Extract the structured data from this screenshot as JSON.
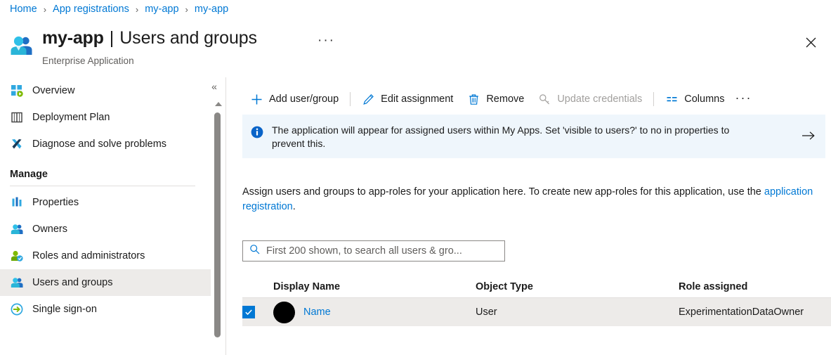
{
  "breadcrumb": {
    "items": [
      "Home",
      "App registrations",
      "my-app",
      "my-app"
    ],
    "separator": "›"
  },
  "header": {
    "icon": "users-group-icon",
    "title_bold": "my-app",
    "title_pipe": "|",
    "title_light": "Users and groups",
    "ellipsis": "···",
    "subtitle": "Enterprise Application",
    "close_icon": "close-icon"
  },
  "sidebar": {
    "collapse_icon": "«",
    "items": [
      {
        "label": "Overview",
        "icon": "overview-icon",
        "selected": false
      },
      {
        "label": "Deployment Plan",
        "icon": "book-icon",
        "selected": false
      },
      {
        "label": "Diagnose and solve problems",
        "icon": "wrench-icon",
        "selected": false
      }
    ],
    "group_label": "Manage",
    "manage_items": [
      {
        "label": "Properties",
        "icon": "properties-icon",
        "selected": false
      },
      {
        "label": "Owners",
        "icon": "owners-icon",
        "selected": false
      },
      {
        "label": "Roles and administrators",
        "icon": "roles-icon",
        "selected": false
      },
      {
        "label": "Users and groups",
        "icon": "users-groups-icon",
        "selected": true
      },
      {
        "label": "Single sign-on",
        "icon": "sso-icon",
        "selected": false
      }
    ]
  },
  "toolbar": {
    "add_label": "Add user/group",
    "edit_label": "Edit assignment",
    "remove_label": "Remove",
    "update_credentials_label": "Update credentials",
    "columns_label": "Columns",
    "more_label": "···"
  },
  "banner": {
    "icon": "info-icon",
    "text": "The application will appear for assigned users within My Apps. Set 'visible to users?' to no in properties to prevent this.",
    "arrow_icon": "arrow-right-icon"
  },
  "description": {
    "text": "Assign users and groups to app-roles for your application here. To create new app-roles for this application, use the ",
    "link": "application registration",
    "tail": "."
  },
  "search": {
    "icon": "search-icon",
    "placeholder": "First 200 shown, to search all users & gro...",
    "value": ""
  },
  "table": {
    "columns": [
      "Display Name",
      "Object Type",
      "Role assigned"
    ],
    "rows": [
      {
        "checked": true,
        "avatar": "avatar-redacted",
        "display_name": "Name",
        "object_type": "User",
        "role_assigned": "ExperimentationDataOwner"
      }
    ]
  },
  "colors": {
    "accent": "#0078d4",
    "banner_bg": "#eff6fc",
    "row_selected_bg": "#edebe9",
    "divider": "#e1dfdd",
    "muted_text": "#605e5c",
    "disabled_text": "#a19f9d"
  }
}
